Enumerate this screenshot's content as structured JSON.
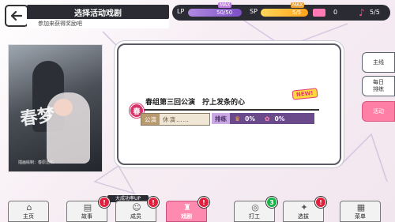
{
  "header": {
    "title": "选择活动戏剧",
    "subtitle": "参加来获得奖励吧",
    "back_icon": "back-arrow-icon"
  },
  "status": {
    "lp_label": "LP",
    "lp_value": "50/50",
    "lp_fraction": 1.0,
    "lp_max_tag": "MAX",
    "sp_label": "SP",
    "sp_value": "5/5",
    "sp_fraction": 1.0,
    "sp_max_tag": "MAX",
    "ticket_value": "0",
    "note_value": "5/5",
    "colors": {
      "lp": "#7c4fc7",
      "sp": "#ffa21a",
      "accent": "#ff4d8a"
    }
  },
  "cover": {
    "calligraphy": "春梦",
    "credits": "插画绘制：春原透和"
  },
  "event": {
    "badge": "春",
    "name": "春组第三回公演　拧上发条的心",
    "new_tag": "NEW!",
    "performance_tag": "公演",
    "performance_value": "休演……",
    "ranking_tag": "排练",
    "crown_percent": "0%",
    "blossom_percent": "0%"
  },
  "side_tabs": [
    {
      "label": "主线",
      "active": false
    },
    {
      "label": "每日\n排练",
      "active": false
    },
    {
      "label": "活动",
      "active": true
    }
  ],
  "nav": {
    "up_banner": "大成功率UP",
    "items": [
      {
        "label": "主页",
        "icon": "home-icon",
        "active": false,
        "badge": ""
      },
      {
        "label": "故事",
        "icon": "book-icon",
        "active": false,
        "badge": "!"
      },
      {
        "label": "成员",
        "icon": "members-icon",
        "active": false,
        "badge": "!"
      },
      {
        "label": "戏剧",
        "icon": "theater-icon",
        "active": true,
        "badge": "!"
      },
      {
        "label": "打工",
        "icon": "coins-icon",
        "active": false,
        "badge": "3"
      },
      {
        "label": "选拔",
        "icon": "gacha-icon",
        "active": false,
        "badge": "!"
      },
      {
        "label": "菜单",
        "icon": "menu-grid-icon",
        "active": false,
        "badge": ""
      }
    ]
  }
}
